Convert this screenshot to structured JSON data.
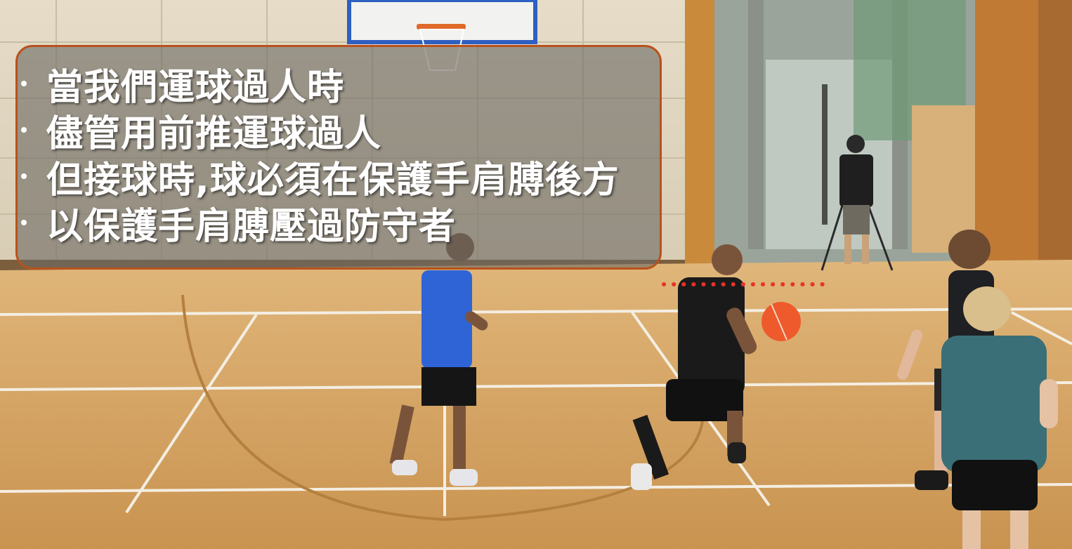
{
  "overlay": {
    "border_color": "#b8521c",
    "lines": [
      "當我們運球過人時",
      "儘管用前推運球過人",
      "但接球時,球必須在保護手肩膊後方",
      "以保護手肩膊壓過防守者"
    ]
  },
  "annotation": {
    "dotted_line_color": "#e8322a"
  },
  "ball_color": "#ee5a2c"
}
